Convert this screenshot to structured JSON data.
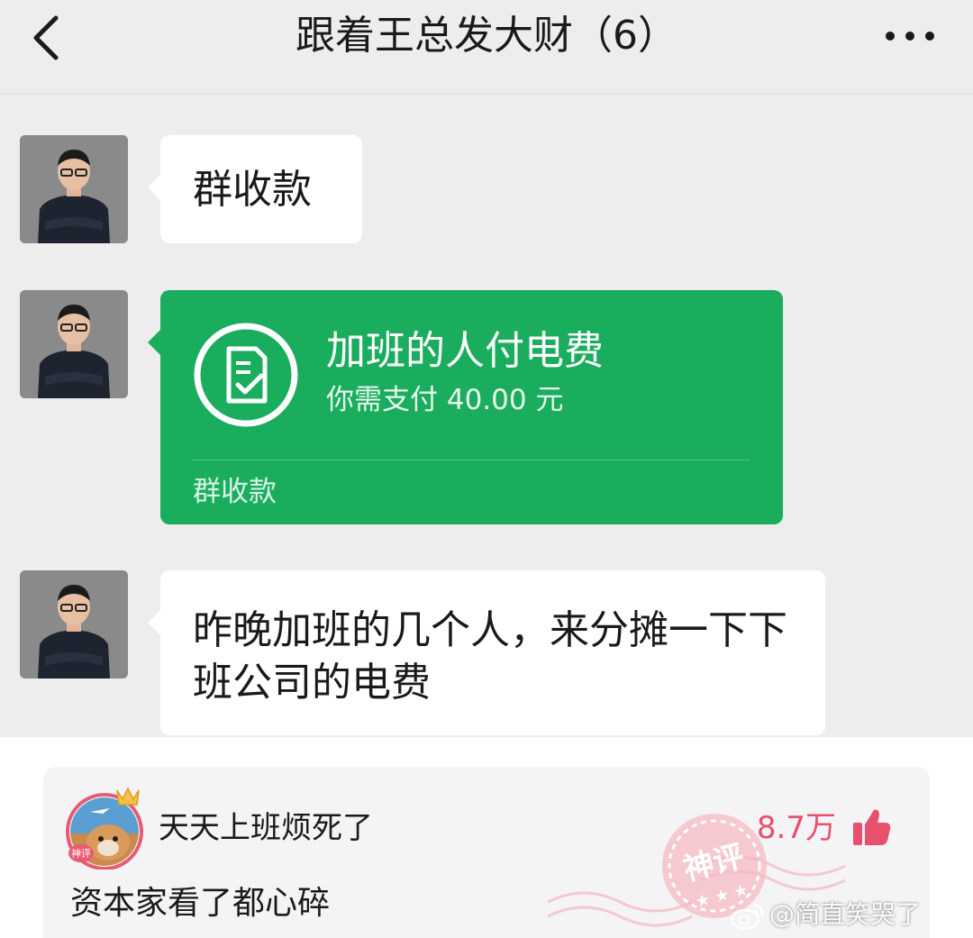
{
  "chat": {
    "title": "跟着王总发大财（6）",
    "messages": [
      {
        "type": "text",
        "text": "群收款"
      },
      {
        "type": "payment",
        "title": "加班的人付电费",
        "amount_text": "你需支付 40.00 元",
        "footer": "群收款"
      },
      {
        "type": "text",
        "text": "昨晚加班的几个人，来分摊一下下班公司的电费"
      }
    ]
  },
  "comment": {
    "username": "天天上班烦死了",
    "text": "资本家看了都心碎",
    "likes": "8.7万",
    "stamp_text": "神评",
    "avatar_badge": "神评"
  },
  "watermark": "@简直笑哭了",
  "colors": {
    "chat_bg": "#ededed",
    "payment_green": "#1aad5e",
    "like_red": "#e8506c"
  }
}
